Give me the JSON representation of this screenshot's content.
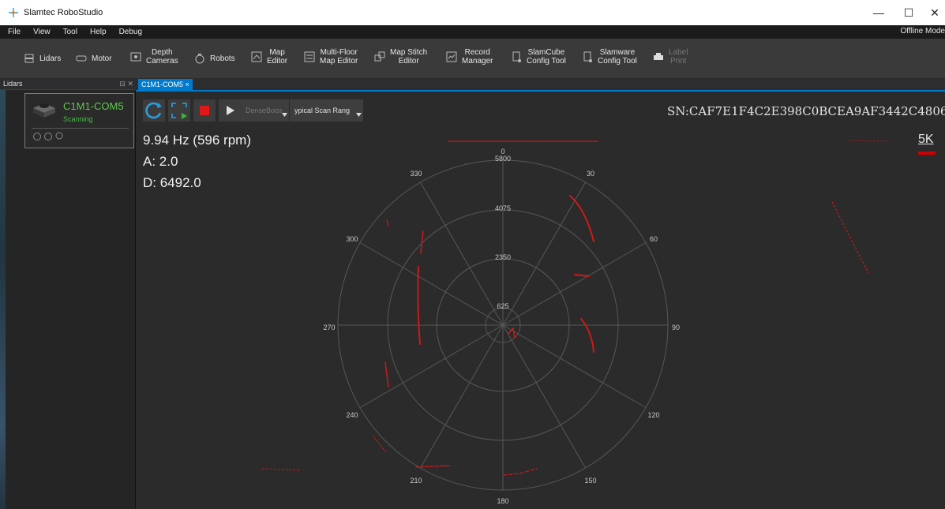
{
  "window": {
    "title": "Slamtec RoboStudio",
    "controls": [
      "—",
      "☐",
      "✕"
    ]
  },
  "menu": {
    "items": [
      "File",
      "View",
      "Tool",
      "Help",
      "Debug"
    ],
    "status": "Offline Mode"
  },
  "toolbar": {
    "items": [
      {
        "label": "Lidars",
        "icon": "lidar-icon"
      },
      {
        "label": "Motor",
        "icon": "motor-icon"
      },
      {
        "label": "Depth\nCameras",
        "icon": "camera-icon"
      },
      {
        "label": "Robots",
        "icon": "robot-icon"
      },
      {
        "label": "Map\nEditor",
        "icon": "map-editor-icon"
      },
      {
        "label": "Multi-Floor\nMap Editor",
        "icon": "multi-floor-icon"
      },
      {
        "label": "Map Stitch\nEditor",
        "icon": "map-stitch-icon"
      },
      {
        "label": "Record\nManager",
        "icon": "record-icon"
      },
      {
        "label": "SlamCube\nConfig Tool",
        "icon": "slamcube-icon"
      },
      {
        "label": "Slamware\nConfig Tool",
        "icon": "slamware-icon"
      },
      {
        "label": "Label\nPrint",
        "icon": "printer-icon"
      }
    ]
  },
  "sidebar": {
    "title": "Lidars",
    "pin": "⊟ ✕",
    "device": {
      "name": "C1M1-COM5",
      "status": "Scanning"
    }
  },
  "tab": {
    "label": "C1M1-COM5 ×"
  },
  "controls": {
    "mode": "DenseBoost",
    "scan_range": "Typical Scan Range",
    "mode_visible": "DenseBoos",
    "range_visible": "ypical Scan Rang"
  },
  "readout": {
    "freq": "9.94 Hz (596 rpm)",
    "angle": "A: 2.0",
    "distance": "D: 6492.0"
  },
  "serial": "SN:CAF7E1F4C2E398C0BCEA9AF3442C4806",
  "resolution": "5K",
  "polar": {
    "angle_labels": [
      "0",
      "30",
      "60",
      "90",
      "120",
      "150",
      "180",
      "210",
      "240",
      "270",
      "300",
      "330"
    ],
    "range_labels": [
      "5800",
      "4075",
      "2350",
      "625"
    ],
    "colors": {
      "scan": "#cc1a1a",
      "grid": "#5a5a5a",
      "text": "#c8c8c8"
    }
  }
}
